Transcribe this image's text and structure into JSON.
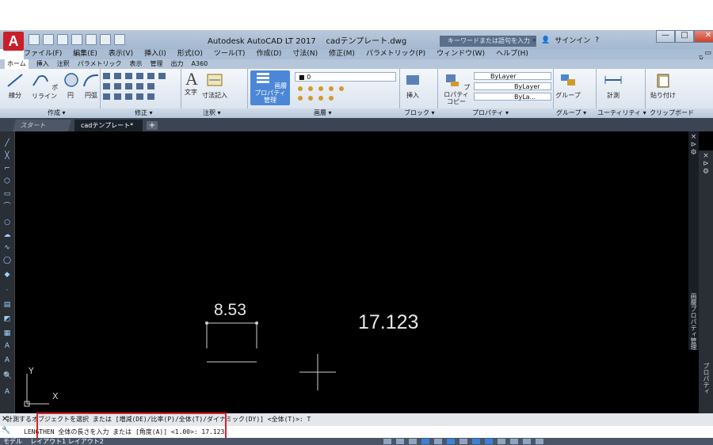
{
  "window": {
    "app_logo": "A",
    "title": "Autodesk AutoCAD LT 2017",
    "document": "cadテンプレート.dwg",
    "search_placeholder": "キーワードまたは語句を入力",
    "signin": "サインイン",
    "controls": {
      "minimize": "—",
      "maximize": "□",
      "close": "✕"
    }
  },
  "menubar": {
    "items": [
      "ファイル(F)",
      "編集(E)",
      "表示(V)",
      "挿入(I)",
      "形式(O)",
      "ツール(T)",
      "作成(D)",
      "寸法(N)",
      "修正(M)",
      "パラメトリック(P)",
      "ウィンドウ(W)",
      "ヘルプ(H)"
    ],
    "mdi": "_ ▭ X"
  },
  "ribbon_tabs": [
    "ホーム",
    "挿入",
    "注釈",
    "パラメトリック",
    "表示",
    "管理",
    "出力",
    "A360"
  ],
  "ribbon": {
    "buttons": {
      "line": "線分",
      "polyline": "ポリライン",
      "circle": "円",
      "arc": "円弧",
      "text": "文字",
      "dimension": "寸法記入",
      "layer_properties": "画層プロパティ\n管理",
      "insert": "挿入",
      "properties": "プロパティ\nコピー",
      "group": "グループ",
      "measure": "計測",
      "paste": "貼り付け",
      "layer_current": "■ 0",
      "bylayer1": "ByLayer",
      "bylayer2": "ByLayer",
      "bylayer3": "ByLa..."
    },
    "groups": [
      "作成 ▾",
      "修正 ▾",
      "注釈 ▾",
      "画層 ▾",
      "ブロック ▾",
      "プロパティ ▾",
      "グループ ▾",
      "ユーティリティ ▾",
      "クリップボード"
    ]
  },
  "file_tabs": {
    "start": "スタート",
    "document": "cadテンプレート*",
    "add": "+"
  },
  "drawing": {
    "dim_small": "8.53",
    "dim_large": "17.123",
    "ucs_y": "Y",
    "ucs_x": "X",
    "props_panel": "画層プロパティ管理",
    "props_panel2": "プロパティ"
  },
  "command": {
    "line1": "計測するオブジェクトを選択 または [増減(DE)/比率(P)/全体(T)/ダイナミック(DY)] <全体(T)>: T",
    "line2": "LENGTHEN 全体の長さを入力 または [角度(A)] <1.00>: 17.123"
  },
  "statusbar": {
    "model": "モデル",
    "layout": "レイアウト1  レイアウト2"
  }
}
